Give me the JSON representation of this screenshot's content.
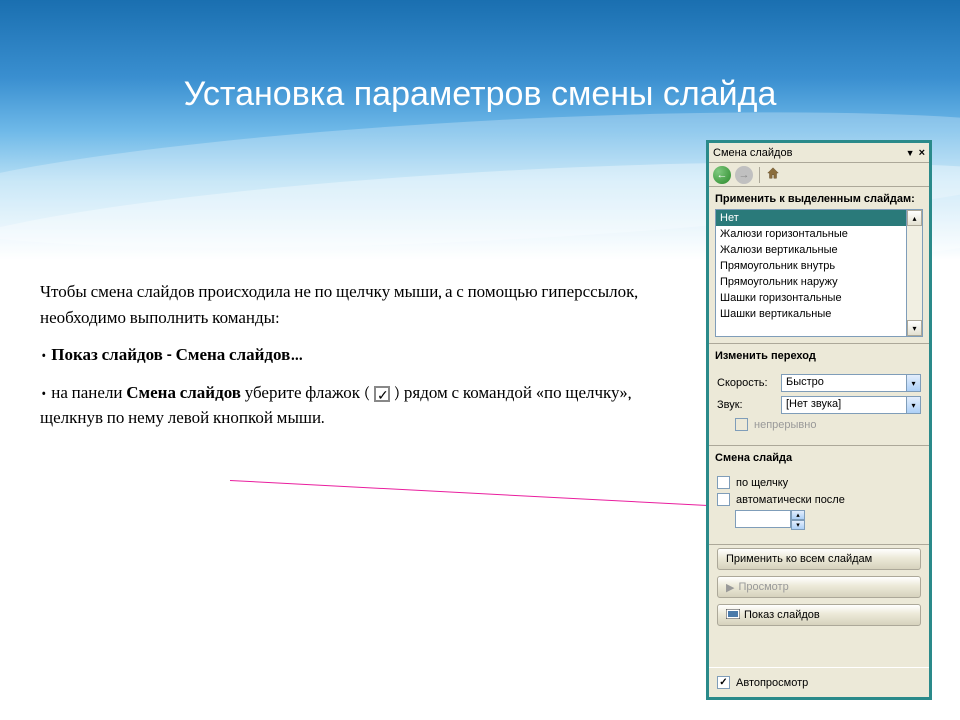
{
  "slide": {
    "title": "Установка параметров смены слайда",
    "paragraph1": "Чтобы смена слайдов происходила не по щелчку мыши, а с помощью гиперссылок, необходимо выполнить команды:",
    "bullet1": "Показ слайдов - Смена слайдов…",
    "bullet2_a": "на панели ",
    "bullet2_b": "Смена слайдов",
    "bullet2_c": " уберите флажок ( ",
    "bullet2_d": " ) рядом с командой «по щелчку», щелкнув по нему левой кнопкой мыши."
  },
  "taskpane": {
    "title": "Смена слайдов",
    "apply_label": "Применить к выделенным слайдам:",
    "list": [
      "Нет",
      "Жалюзи горизонтальные",
      "Жалюзи вертикальные",
      "Прямоугольник внутрь",
      "Прямоугольник наружу",
      "Шашки горизонтальные",
      "Шашки вертикальные"
    ],
    "selected_index": 0,
    "modify_label": "Изменить переход",
    "speed_label": "Скорость:",
    "speed_value": "Быстро",
    "sound_label": "Звук:",
    "sound_value": "[Нет звука]",
    "loop_label": "непрерывно",
    "advance_label": "Смена слайда",
    "onclick_label": "по щелчку",
    "autoafter_label": "автоматически после",
    "apply_all": "Применить ко всем слайдам",
    "play": "Просмотр",
    "slideshow": "Показ слайдов",
    "autopreview": "Автопросмотр"
  }
}
